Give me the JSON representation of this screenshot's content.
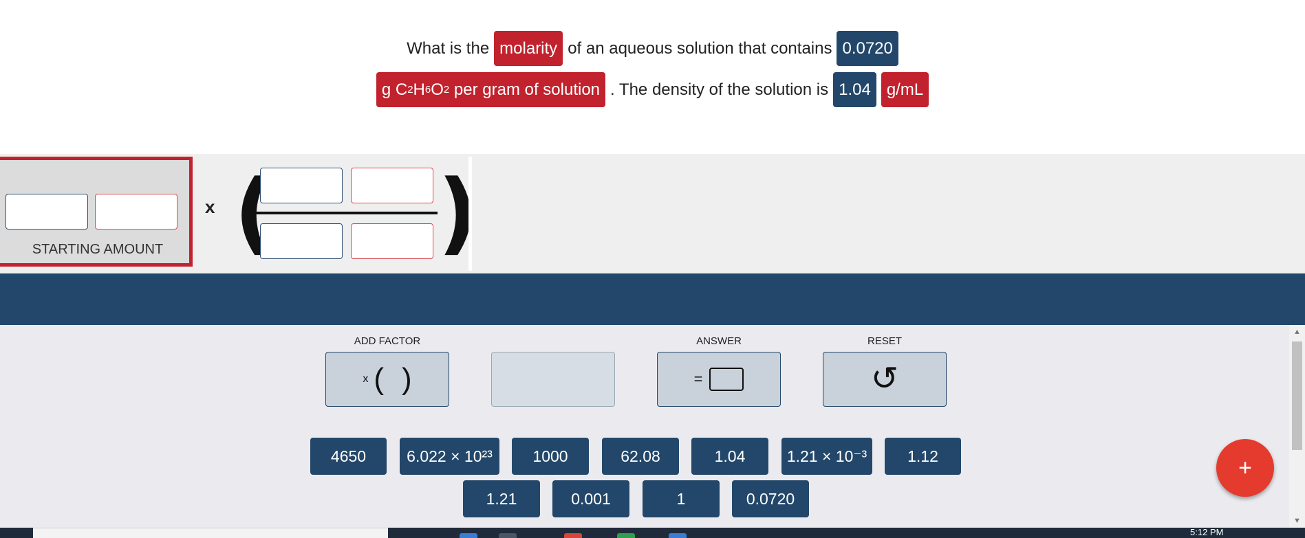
{
  "question": {
    "line1": {
      "t1": "What is the",
      "chip_molarity": "molarity",
      "t2": "of an aqueous solution that contains",
      "chip_amount": "0.0720"
    },
    "line2": {
      "chip_unit_prefix": "g C",
      "chip_unit_sub1": "2",
      "chip_unit_h": "H",
      "chip_unit_sub2": "6",
      "chip_unit_o": "O",
      "chip_unit_sub3": "2",
      "chip_unit_suffix": " per gram of solution",
      "t3": ". The density of the solution is",
      "chip_density": "1.04",
      "chip_density_unit": "g/mL"
    }
  },
  "workspace": {
    "start_label": "STARTING AMOUNT",
    "times": "x",
    "paren_open": "(",
    "paren_close": ")"
  },
  "tools": {
    "add_factor_label": "ADD FACTOR",
    "add_factor_glyph_x": "x",
    "add_factor_glyph_open": "(",
    "add_factor_glyph_close": ")",
    "answer_label": "ANSWER",
    "answer_glyph_eq": "=",
    "reset_label": "RESET",
    "reset_glyph": "↺"
  },
  "numbers": {
    "row1": [
      "4650",
      "6.022 × 10²³",
      "1000",
      "62.08",
      "1.04",
      "1.21 × 10⁻³",
      "1.12"
    ],
    "row2": [
      "1.21",
      "0.001",
      "1",
      "0.0720"
    ]
  },
  "fab": {
    "label": "+"
  },
  "taskbar": {
    "time": "5:12 PM"
  },
  "colors": {
    "red_chip": "#c1222d",
    "blue_chip": "#23476a",
    "fab": "#e53a2e",
    "workspace_bg": "#efefef"
  }
}
